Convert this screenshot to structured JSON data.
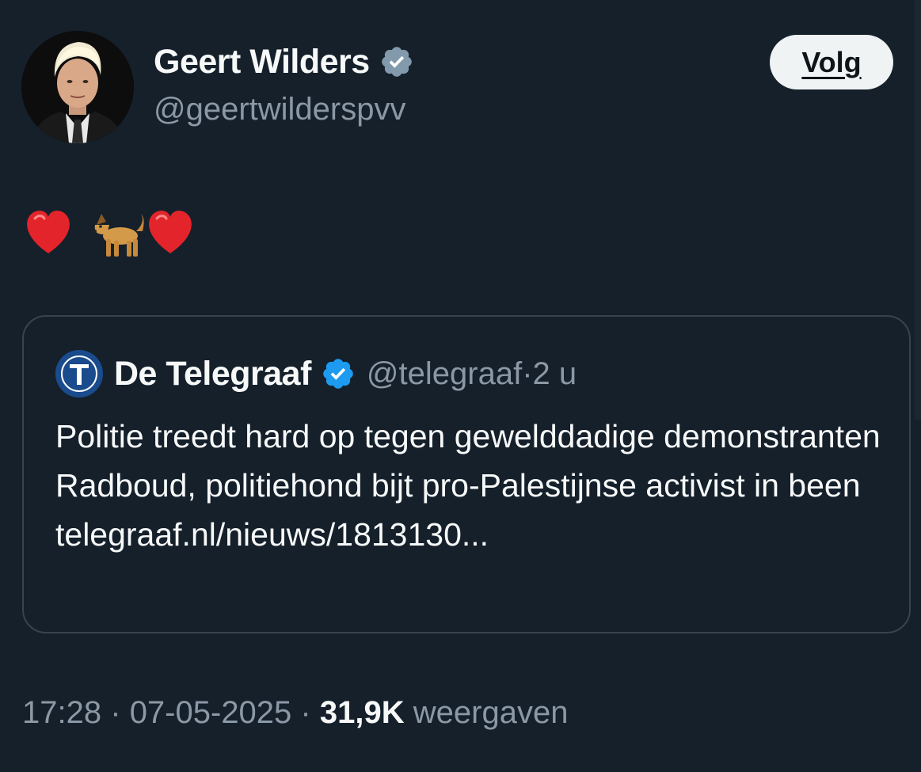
{
  "author": {
    "name": "Geert Wilders",
    "handle": "@geertwilderspvv",
    "verified_icon": "verified-badge-gray-icon",
    "avatar_icon": "avatar-portrait"
  },
  "follow_button": {
    "label": "Volg"
  },
  "tweet": {
    "text": "❤️ 🐕❤️"
  },
  "quoted_tweet": {
    "author_name": "De Telegraaf",
    "logo_icon": "telegraaf-logo",
    "verified_icon": "verified-badge-blue-icon",
    "handle": "@telegraaf",
    "separator": "·",
    "time_ago": "2 u",
    "text": "Politie treedt hard op tegen gewelddadige demonstranten Radboud, politiehond bijt pro-Palestijnse activist in been telegraaf.nl/nieuws/1813130..."
  },
  "footer": {
    "time": "17:28",
    "separator1": "·",
    "date": "07-05-2025",
    "separator2": "·",
    "views_count": "31,9K",
    "views_label": "weergaven"
  },
  "colors": {
    "background": "#15202b",
    "text_primary": "#f7f9f9",
    "text_secondary": "#8b98a5",
    "border": "#38444d",
    "button_bg": "#eff3f4",
    "verified_blue": "#1d9bf0",
    "verified_gray": "#829aab"
  }
}
